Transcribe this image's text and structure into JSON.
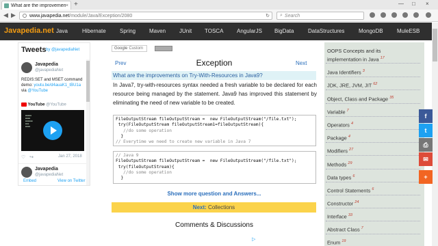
{
  "browser": {
    "tab_title": "What are the improvements...",
    "tab_close": "×",
    "new_tab": "+",
    "url_host": "www.javapedia.net",
    "url_path": "/module/Java/Exception/2080",
    "search_placeholder": "Search",
    "win_min": "—",
    "win_max": "□",
    "win_close": "×"
  },
  "site": {
    "logo": "Javapedia.net",
    "nav": [
      "Java",
      "Hibernate",
      "Spring",
      "Maven",
      "JUnit",
      "TOSCA",
      "AngularJS",
      "BigData",
      "DataStructures",
      "MongoDB",
      "MuleESB"
    ]
  },
  "twitter": {
    "title": "Tweets",
    "by": "by @javapediaNet",
    "tweet1_name": "Javapedia",
    "tweet1_handle": "@javapediaNet",
    "tweet1_text": "REDIS:SET and MSET command demo:",
    "tweet1_link": "youtu.be/d4auaK1_tBU1a",
    "tweet1_via": "via",
    "tweet1_yt": "@YouTube",
    "yt_label": "YouTube",
    "yt_handle": "@YouTube",
    "tweet1_date": "Jan 27, 2018",
    "tweet2_name": "Javapedia",
    "tweet2_handle": "@javapediaNet",
    "embed": "Embed",
    "view": "View on Twitter"
  },
  "search": {
    "google": "Google",
    "custom": "Custom"
  },
  "content": {
    "prev": "Prev",
    "next": "Next",
    "title": "Exception",
    "question": "What are the improvements on Try-With-Resources in Java9?",
    "answer": "In Java7, try-with-resources syntax needed a fresh variable to be declared for each resource being managed by the statement. Java9 has improved this statement by eliminating the need of new variable to be created.",
    "code1": [
      "FileOutputStream fileOutputStream =  new FileOutputStream(\"/file.txt\");",
      " try(FileOutputStream fileOutputStream1=fileOutputStream){",
      "   //do some operation",
      "  }",
      "// Everytime we need to create new variable in Java 7"
    ],
    "code2": [
      "// Java 9",
      "FileOutputStream fileOutputStream =  new FileOutputStream(\"/file.txt\");",
      " try(fileOutputStream){",
      "   //do some operation",
      "  }"
    ],
    "more": "Show more question and Answers...",
    "next_label": "Next:",
    "next_target": "Collections",
    "comments": "Comments & Discussions"
  },
  "sidebar": [
    {
      "label": "OOPS Concepts and its implementation in Java",
      "count": "17"
    },
    {
      "label": "Java Identifiers",
      "count": "3"
    },
    {
      "label": "JDK, JRE, JVM, JIT",
      "count": "62"
    },
    {
      "label": "Object, Class and Package",
      "count": "35"
    },
    {
      "label": "Variable",
      "count": "7"
    },
    {
      "label": "Operators",
      "count": "4"
    },
    {
      "label": "Package",
      "count": "4"
    },
    {
      "label": "Modifiers",
      "count": "27"
    },
    {
      "label": "Methods",
      "count": "29"
    },
    {
      "label": "Data types",
      "count": "6"
    },
    {
      "label": "Control Statements",
      "count": "6"
    },
    {
      "label": "Constructor",
      "count": "24"
    },
    {
      "label": "Interface",
      "count": "33"
    },
    {
      "label": "Abstract Class",
      "count": "7"
    },
    {
      "label": "Enum",
      "count": "19"
    }
  ],
  "share": {
    "facebook": "f",
    "twitter": "t",
    "print": "⎙",
    "email": "✉",
    "more": "+"
  }
}
